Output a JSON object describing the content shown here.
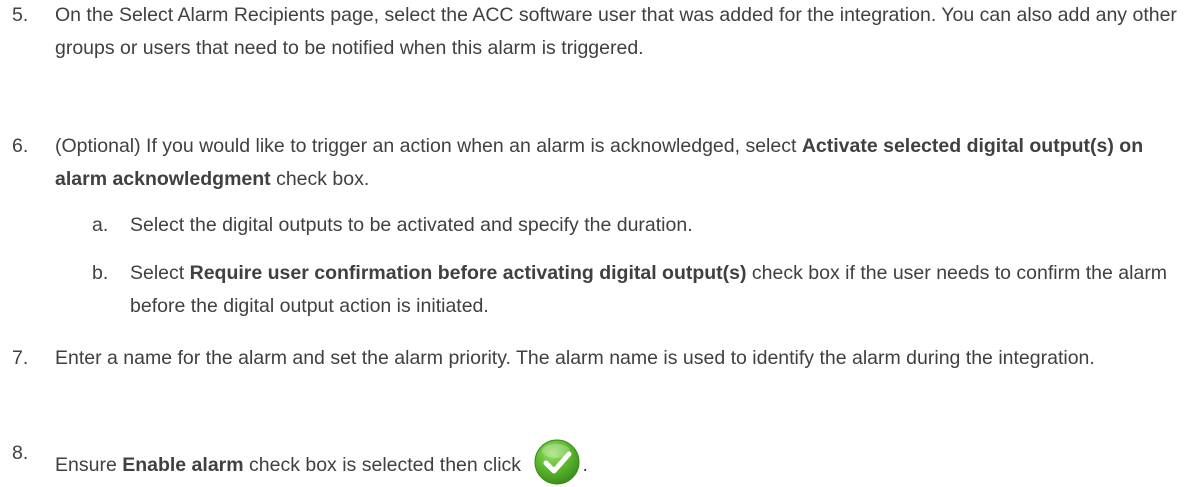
{
  "steps": [
    {
      "number": "5.",
      "text": "On the Select Alarm Recipients page, select the ACC software user that was added for the integration. You can also add any other groups or users that need to be notified when this alarm is triggered."
    },
    {
      "number": "6.",
      "pre": "(Optional) If you would like to trigger an action when an alarm is acknowledged, select ",
      "bold": "Activate selected digital output(s) on alarm acknowledgment",
      "post": " check box.",
      "substeps": [
        {
          "letter": "a.",
          "text": "Select the digital outputs to be activated and specify the duration."
        },
        {
          "letter": "b.",
          "pre": "Select ",
          "bold": "Require user confirmation before activating digital output(s)",
          "post": " check box if the user needs to confirm the alarm before the digital output action is initiated."
        }
      ]
    },
    {
      "number": "7.",
      "text": "Enter a name for the alarm and set the alarm priority. The alarm name is used to identify the alarm during the integration."
    },
    {
      "number": "8.",
      "pre": "Ensure ",
      "bold": "Enable alarm",
      "post": " check box is selected then click ",
      "end": ".",
      "icon": "ok-checkmark-icon",
      "icon_color": "#5cb82e"
    }
  ]
}
